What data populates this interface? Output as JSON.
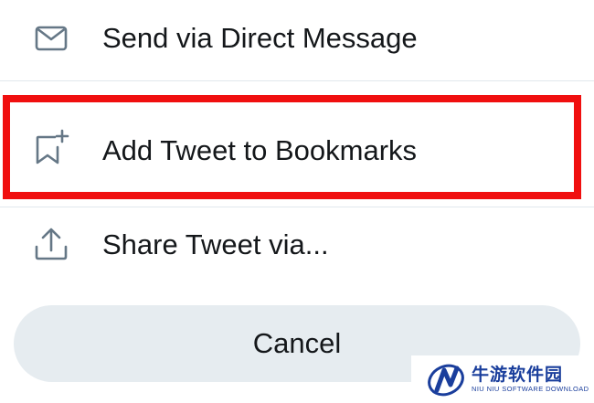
{
  "menu": {
    "items": [
      {
        "label": "Send via Direct Message",
        "icon": "envelope-icon"
      },
      {
        "label": "Add Tweet to Bookmarks",
        "icon": "bookmark-add-icon",
        "highlighted": true
      },
      {
        "label": "Share Tweet via...",
        "icon": "share-icon"
      }
    ],
    "cancel_label": "Cancel"
  },
  "watermark": {
    "title": "牛游软件园",
    "subtitle": "NIU NIU SOFTWARE DOWNLOAD"
  },
  "colors": {
    "icon": "#657786",
    "text": "#14171a",
    "highlight_border": "#f00f0f",
    "cancel_bg": "#e6ecf0",
    "watermark": "#1a3e9c"
  }
}
